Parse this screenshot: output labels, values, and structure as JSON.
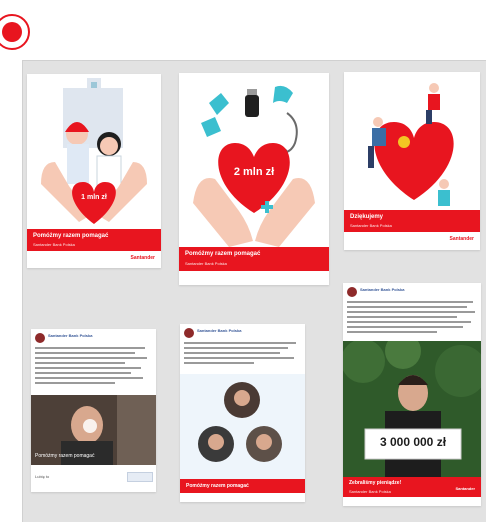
{
  "record_control": {
    "icon": "record-dot-icon",
    "color": "#e8151f"
  },
  "colors": {
    "brand_red": "#e8151f",
    "panel_bg": "#e2e2e2",
    "skin": "#f6c9b5"
  },
  "cards": [
    {
      "heart_text": "1 mln zł",
      "band_title": "Pomóżmy razem pomagać",
      "band_sub": "Santander Bank Polska",
      "brand": "Santander"
    },
    {
      "heart_text": "2 mln zł",
      "band_title": "Pomóżmy razem pomagać",
      "band_sub": "Santander Bank Polska",
      "brand": "Santander"
    },
    {
      "band_title": "Dziękujemy",
      "band_sub": "Santander Bank Polska",
      "brand": "Santander"
    },
    {
      "post_author": "Santander Bank Polska",
      "video_caption": "Pomóżmy razem pomagać",
      "footer": "Lubię to"
    },
    {
      "post_author": "Santander Bank Polska",
      "band_title": "Pomóżmy razem pomagać"
    },
    {
      "post_author": "Santander Bank Polska",
      "sign_text": "3 000 000 zł",
      "band_title": "Zebraliśmy pieniądze!",
      "band_sub": "Santander Bank Polska",
      "brand": "Santander"
    }
  ]
}
